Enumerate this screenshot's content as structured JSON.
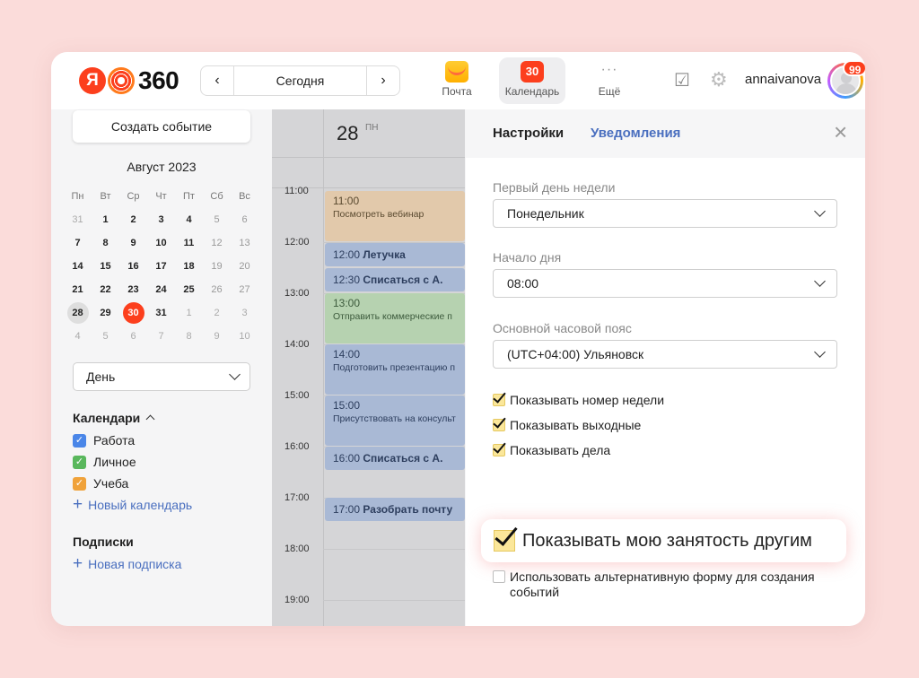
{
  "header": {
    "logo_ya": "Я",
    "logo_num": "360",
    "nav_prev": "‹",
    "nav_today": "Сегодня",
    "nav_next": "›",
    "services": [
      {
        "label": "Почта",
        "icon": "mail-icon"
      },
      {
        "label": "Календарь",
        "icon": "calendar-icon",
        "badge": "30"
      },
      {
        "label": "Ещё",
        "icon": "more-icon",
        "glyph": "···"
      }
    ],
    "tasks_icon": "☑",
    "gear_icon": "⚙",
    "username": "annaivanova",
    "avatar_badge": "99"
  },
  "sidebar": {
    "create_button": "Создать событие",
    "month_title": "Август 2023",
    "weekdays": [
      "Пн",
      "Вт",
      "Ср",
      "Чт",
      "Пт",
      "Сб",
      "Вс"
    ],
    "weeks": [
      [
        "31",
        "1",
        "2",
        "3",
        "4",
        "5",
        "6"
      ],
      [
        "7",
        "8",
        "9",
        "10",
        "11",
        "12",
        "13"
      ],
      [
        "14",
        "15",
        "16",
        "17",
        "18",
        "19",
        "20"
      ],
      [
        "21",
        "22",
        "23",
        "24",
        "25",
        "26",
        "27"
      ],
      [
        "28",
        "29",
        "30",
        "31",
        "1",
        "2",
        "3"
      ],
      [
        "4",
        "5",
        "6",
        "7",
        "8",
        "9",
        "10"
      ]
    ],
    "view_select": "День",
    "calendars_title": "Календари",
    "calendars": [
      {
        "label": "Работа",
        "color": "#4a86e8"
      },
      {
        "label": "Личное",
        "color": "#59b75c"
      },
      {
        "label": "Учеба",
        "color": "#f0a23a"
      }
    ],
    "new_calendar": "Новый календарь",
    "subscriptions_title": "Подписки",
    "new_subscription": "Новая подписка"
  },
  "day_view": {
    "day_number": "28",
    "day_name": "ПН",
    "hours": [
      "11:00",
      "12:00",
      "13:00",
      "14:00",
      "15:00",
      "16:00",
      "17:00",
      "18:00",
      "19:00"
    ],
    "events": [
      {
        "time": "11:00",
        "title": "Посмотреть вебинар",
        "color": "#e2c9ab"
      },
      {
        "time": "12:00",
        "title": "Летучка",
        "color": "#a9b9d5"
      },
      {
        "time": "12:30",
        "title": "Списаться с А.",
        "color": "#a9b9d5"
      },
      {
        "time": "13:00",
        "title": "Отправить коммерческие п",
        "color": "#b6d2b0"
      },
      {
        "time": "14:00",
        "title": "Подготовить презентацию п",
        "color": "#a9b9d5"
      },
      {
        "time": "15:00",
        "title": "Присутствовать на консульт",
        "color": "#a9b9d5"
      },
      {
        "time": "16:00",
        "title": "Списаться с А.",
        "color": "#a9b9d5"
      },
      {
        "time": "17:00",
        "title": "Разобрать почту",
        "color": "#a9b9d5"
      }
    ]
  },
  "settings": {
    "tab_settings": "Настройки",
    "tab_notifications": "Уведомления",
    "close_icon": "×",
    "first_day_label": "Первый день недели",
    "first_day_value": "Понедельник",
    "day_start_label": "Начало дня",
    "day_start_value": "08:00",
    "timezone_label": "Основной часовой пояс",
    "timezone_value": "(UTC+04:00) Ульяновск",
    "show_week_number": "Показывать номер недели",
    "show_weekends": "Показывать выходные",
    "show_tasks": "Показывать дела",
    "show_busy": "Показывать мою занятость другим",
    "alt_form": "Использовать альтернативную форму для создания событий"
  },
  "colors": {
    "accent": "#fc3f1d",
    "link": "#4a6fbf",
    "checkbox": "#fbe79a",
    "background": "#fbdcda"
  }
}
